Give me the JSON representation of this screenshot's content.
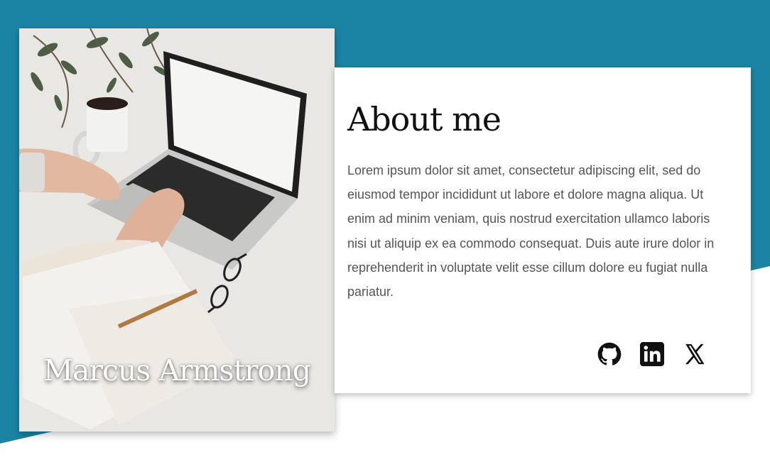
{
  "profile": {
    "name": "Marcus Armstrong"
  },
  "about": {
    "title": "About me",
    "body": "Lorem ipsum dolor sit amet, consectetur adipiscing elit, sed do eiusmod tempor incididunt ut labore et dolore magna aliqua. Ut enim ad minim veniam, quis nostrud exercitation ullamco laboris nisi ut aliquip ex ea commodo consequat. Duis aute irure dolor in reprehenderit in voluptate velit esse cillum dolore eu fugiat nulla pariatur."
  },
  "socials": [
    {
      "icon": "github-icon"
    },
    {
      "icon": "linkedin-icon"
    },
    {
      "icon": "x-icon"
    }
  ],
  "colors": {
    "band": "#1b84a5",
    "card": "#ffffff",
    "text": "#555555",
    "heading": "#111111"
  }
}
